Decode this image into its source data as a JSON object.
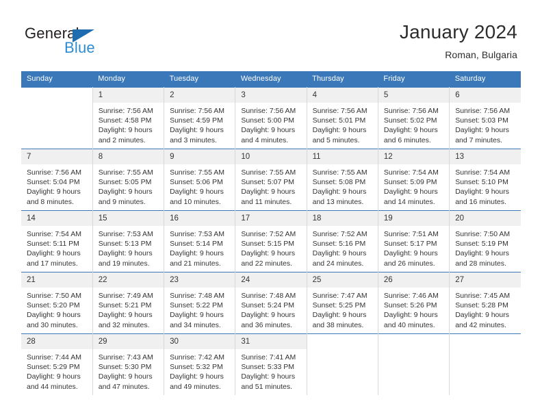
{
  "brand": {
    "name_part1": "General",
    "name_part2": "Blue"
  },
  "header": {
    "title": "January 2024",
    "subtitle": "Roman, Bulgaria"
  },
  "colors": {
    "header_blue": "#3a78b9",
    "brand_blue": "#2e8bd0",
    "flag_blue": "#1f6cb0",
    "daynum_band": "#f0f0f0",
    "cell_border": "#d8d8d8",
    "text": "#333333"
  },
  "weekdays": [
    "Sunday",
    "Monday",
    "Tuesday",
    "Wednesday",
    "Thursday",
    "Friday",
    "Saturday"
  ],
  "weeks": [
    [
      {
        "day": "",
        "sunrise": "",
        "sunset": "",
        "daylight1": "",
        "daylight2": ""
      },
      {
        "day": "1",
        "sunrise": "Sunrise: 7:56 AM",
        "sunset": "Sunset: 4:58 PM",
        "daylight1": "Daylight: 9 hours",
        "daylight2": "and 2 minutes."
      },
      {
        "day": "2",
        "sunrise": "Sunrise: 7:56 AM",
        "sunset": "Sunset: 4:59 PM",
        "daylight1": "Daylight: 9 hours",
        "daylight2": "and 3 minutes."
      },
      {
        "day": "3",
        "sunrise": "Sunrise: 7:56 AM",
        "sunset": "Sunset: 5:00 PM",
        "daylight1": "Daylight: 9 hours",
        "daylight2": "and 4 minutes."
      },
      {
        "day": "4",
        "sunrise": "Sunrise: 7:56 AM",
        "sunset": "Sunset: 5:01 PM",
        "daylight1": "Daylight: 9 hours",
        "daylight2": "and 5 minutes."
      },
      {
        "day": "5",
        "sunrise": "Sunrise: 7:56 AM",
        "sunset": "Sunset: 5:02 PM",
        "daylight1": "Daylight: 9 hours",
        "daylight2": "and 6 minutes."
      },
      {
        "day": "6",
        "sunrise": "Sunrise: 7:56 AM",
        "sunset": "Sunset: 5:03 PM",
        "daylight1": "Daylight: 9 hours",
        "daylight2": "and 7 minutes."
      }
    ],
    [
      {
        "day": "7",
        "sunrise": "Sunrise: 7:56 AM",
        "sunset": "Sunset: 5:04 PM",
        "daylight1": "Daylight: 9 hours",
        "daylight2": "and 8 minutes."
      },
      {
        "day": "8",
        "sunrise": "Sunrise: 7:55 AM",
        "sunset": "Sunset: 5:05 PM",
        "daylight1": "Daylight: 9 hours",
        "daylight2": "and 9 minutes."
      },
      {
        "day": "9",
        "sunrise": "Sunrise: 7:55 AM",
        "sunset": "Sunset: 5:06 PM",
        "daylight1": "Daylight: 9 hours",
        "daylight2": "and 10 minutes."
      },
      {
        "day": "10",
        "sunrise": "Sunrise: 7:55 AM",
        "sunset": "Sunset: 5:07 PM",
        "daylight1": "Daylight: 9 hours",
        "daylight2": "and 11 minutes."
      },
      {
        "day": "11",
        "sunrise": "Sunrise: 7:55 AM",
        "sunset": "Sunset: 5:08 PM",
        "daylight1": "Daylight: 9 hours",
        "daylight2": "and 13 minutes."
      },
      {
        "day": "12",
        "sunrise": "Sunrise: 7:54 AM",
        "sunset": "Sunset: 5:09 PM",
        "daylight1": "Daylight: 9 hours",
        "daylight2": "and 14 minutes."
      },
      {
        "day": "13",
        "sunrise": "Sunrise: 7:54 AM",
        "sunset": "Sunset: 5:10 PM",
        "daylight1": "Daylight: 9 hours",
        "daylight2": "and 16 minutes."
      }
    ],
    [
      {
        "day": "14",
        "sunrise": "Sunrise: 7:54 AM",
        "sunset": "Sunset: 5:11 PM",
        "daylight1": "Daylight: 9 hours",
        "daylight2": "and 17 minutes."
      },
      {
        "day": "15",
        "sunrise": "Sunrise: 7:53 AM",
        "sunset": "Sunset: 5:13 PM",
        "daylight1": "Daylight: 9 hours",
        "daylight2": "and 19 minutes."
      },
      {
        "day": "16",
        "sunrise": "Sunrise: 7:53 AM",
        "sunset": "Sunset: 5:14 PM",
        "daylight1": "Daylight: 9 hours",
        "daylight2": "and 21 minutes."
      },
      {
        "day": "17",
        "sunrise": "Sunrise: 7:52 AM",
        "sunset": "Sunset: 5:15 PM",
        "daylight1": "Daylight: 9 hours",
        "daylight2": "and 22 minutes."
      },
      {
        "day": "18",
        "sunrise": "Sunrise: 7:52 AM",
        "sunset": "Sunset: 5:16 PM",
        "daylight1": "Daylight: 9 hours",
        "daylight2": "and 24 minutes."
      },
      {
        "day": "19",
        "sunrise": "Sunrise: 7:51 AM",
        "sunset": "Sunset: 5:17 PM",
        "daylight1": "Daylight: 9 hours",
        "daylight2": "and 26 minutes."
      },
      {
        "day": "20",
        "sunrise": "Sunrise: 7:50 AM",
        "sunset": "Sunset: 5:19 PM",
        "daylight1": "Daylight: 9 hours",
        "daylight2": "and 28 minutes."
      }
    ],
    [
      {
        "day": "21",
        "sunrise": "Sunrise: 7:50 AM",
        "sunset": "Sunset: 5:20 PM",
        "daylight1": "Daylight: 9 hours",
        "daylight2": "and 30 minutes."
      },
      {
        "day": "22",
        "sunrise": "Sunrise: 7:49 AM",
        "sunset": "Sunset: 5:21 PM",
        "daylight1": "Daylight: 9 hours",
        "daylight2": "and 32 minutes."
      },
      {
        "day": "23",
        "sunrise": "Sunrise: 7:48 AM",
        "sunset": "Sunset: 5:22 PM",
        "daylight1": "Daylight: 9 hours",
        "daylight2": "and 34 minutes."
      },
      {
        "day": "24",
        "sunrise": "Sunrise: 7:48 AM",
        "sunset": "Sunset: 5:24 PM",
        "daylight1": "Daylight: 9 hours",
        "daylight2": "and 36 minutes."
      },
      {
        "day": "25",
        "sunrise": "Sunrise: 7:47 AM",
        "sunset": "Sunset: 5:25 PM",
        "daylight1": "Daylight: 9 hours",
        "daylight2": "and 38 minutes."
      },
      {
        "day": "26",
        "sunrise": "Sunrise: 7:46 AM",
        "sunset": "Sunset: 5:26 PM",
        "daylight1": "Daylight: 9 hours",
        "daylight2": "and 40 minutes."
      },
      {
        "day": "27",
        "sunrise": "Sunrise: 7:45 AM",
        "sunset": "Sunset: 5:28 PM",
        "daylight1": "Daylight: 9 hours",
        "daylight2": "and 42 minutes."
      }
    ],
    [
      {
        "day": "28",
        "sunrise": "Sunrise: 7:44 AM",
        "sunset": "Sunset: 5:29 PM",
        "daylight1": "Daylight: 9 hours",
        "daylight2": "and 44 minutes."
      },
      {
        "day": "29",
        "sunrise": "Sunrise: 7:43 AM",
        "sunset": "Sunset: 5:30 PM",
        "daylight1": "Daylight: 9 hours",
        "daylight2": "and 47 minutes."
      },
      {
        "day": "30",
        "sunrise": "Sunrise: 7:42 AM",
        "sunset": "Sunset: 5:32 PM",
        "daylight1": "Daylight: 9 hours",
        "daylight2": "and 49 minutes."
      },
      {
        "day": "31",
        "sunrise": "Sunrise: 7:41 AM",
        "sunset": "Sunset: 5:33 PM",
        "daylight1": "Daylight: 9 hours",
        "daylight2": "and 51 minutes."
      },
      {
        "day": "",
        "sunrise": "",
        "sunset": "",
        "daylight1": "",
        "daylight2": ""
      },
      {
        "day": "",
        "sunrise": "",
        "sunset": "",
        "daylight1": "",
        "daylight2": ""
      },
      {
        "day": "",
        "sunrise": "",
        "sunset": "",
        "daylight1": "",
        "daylight2": ""
      }
    ]
  ]
}
